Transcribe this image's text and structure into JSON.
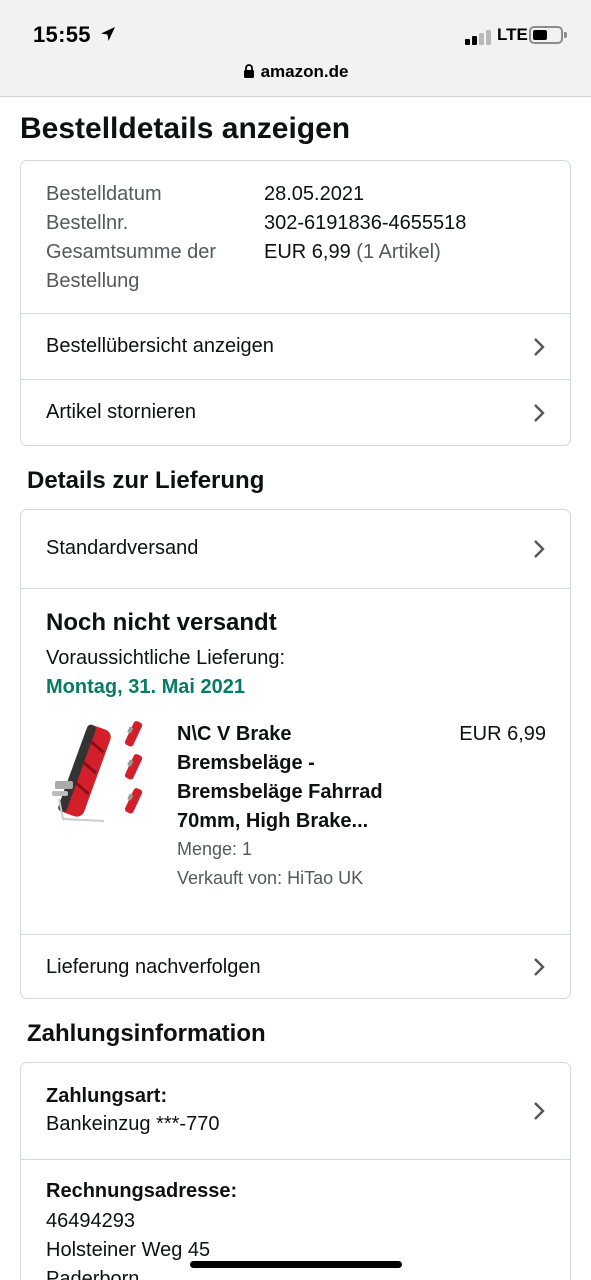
{
  "status_bar": {
    "time": "15:55",
    "network": "LTE"
  },
  "browser": {
    "url": "amazon.de"
  },
  "page_title": "Bestelldetails anzeigen",
  "order": {
    "date_label": "Bestelldatum",
    "date_value": "28.05.2021",
    "number_label": "Bestellnr.",
    "number_value": "302-6191836-4655518",
    "total_label_1": "Gesamtsumme der",
    "total_label_2": "Bestellung",
    "total_value": "EUR 6,99",
    "total_count": "(1 Artikel)",
    "summary_link": "Bestellübersicht anzeigen",
    "cancel_link": "Artikel stornieren"
  },
  "delivery": {
    "section_title": "Details zur Lieferung",
    "shipping_method": "Standardversand",
    "status": "Noch nicht versandt",
    "eta_label": "Voraussichtliche Lieferung:",
    "eta_date": "Montag, 31. Mai 2021",
    "product": {
      "title_lines": [
        "N\\C V Brake",
        "Bremsbeläge -",
        "Bremsbeläge Fahrrad",
        "70mm, High Brake..."
      ],
      "price": "EUR 6,99",
      "quantity": "Menge: 1",
      "seller": "Verkauft von: HiTao UK"
    },
    "track_link": "Lieferung nachverfolgen"
  },
  "payment": {
    "section_title": "Zahlungsinformation",
    "method_label": "Zahlungsart:",
    "method_value": "Bankeinzug ***-770",
    "billing_label": "Rechnungsadresse:",
    "billing_lines": [
      "46494293",
      "Holsteiner Weg 45",
      "Paderborn"
    ]
  },
  "colors": {
    "delivery_green": "#067d62",
    "border": "#d5d9d9",
    "muted_text": "#565959"
  },
  "icons": [
    "location-arrow-icon",
    "signal-icon",
    "battery-icon",
    "lock-icon",
    "chevron-right-icon",
    "product-thumbnail"
  ]
}
